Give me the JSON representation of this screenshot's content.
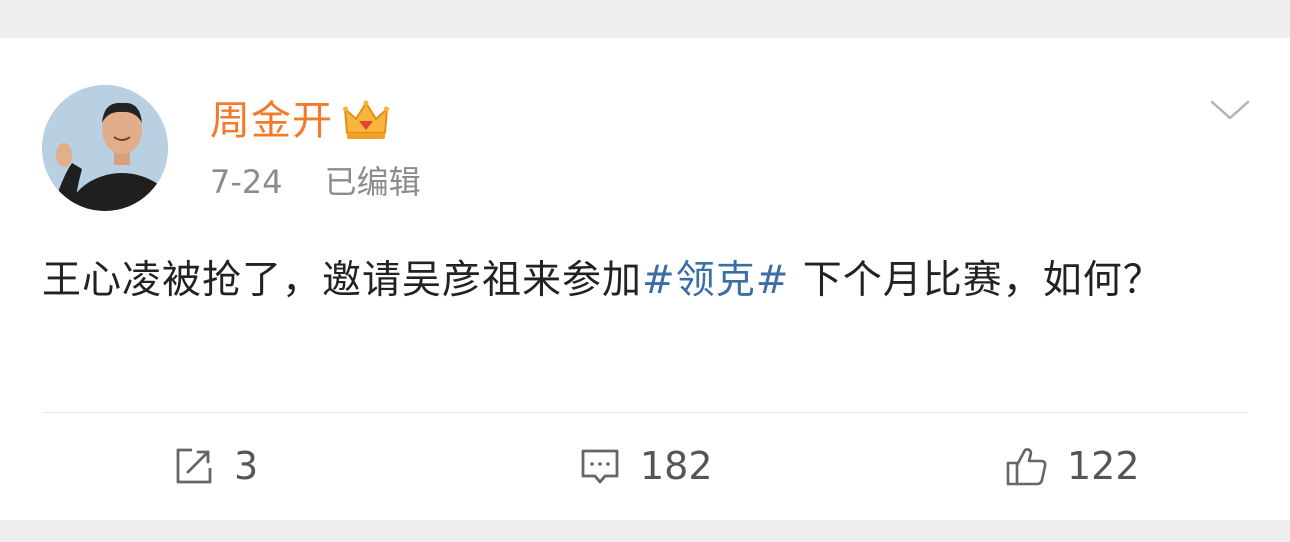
{
  "post": {
    "username": "周金开",
    "date": "7-24",
    "edited_label": "已编辑",
    "text_before": "王心凌被抢了，邀请吴彦祖来参加",
    "hashtag": "#领克#",
    "text_after": " 下个月比赛，如何？"
  },
  "actions": {
    "repost_count": "3",
    "comment_count": "182",
    "like_count": "122"
  },
  "icons": {
    "vip": "crown-icon",
    "menu": "chevron-down-icon",
    "repost": "repost-icon",
    "comment": "comment-icon",
    "like": "thumbs-up-icon"
  },
  "colors": {
    "username": "#f47a2b",
    "hashtag": "#3a6ea5",
    "meta": "#8c8c8c",
    "background": "#efefef"
  }
}
